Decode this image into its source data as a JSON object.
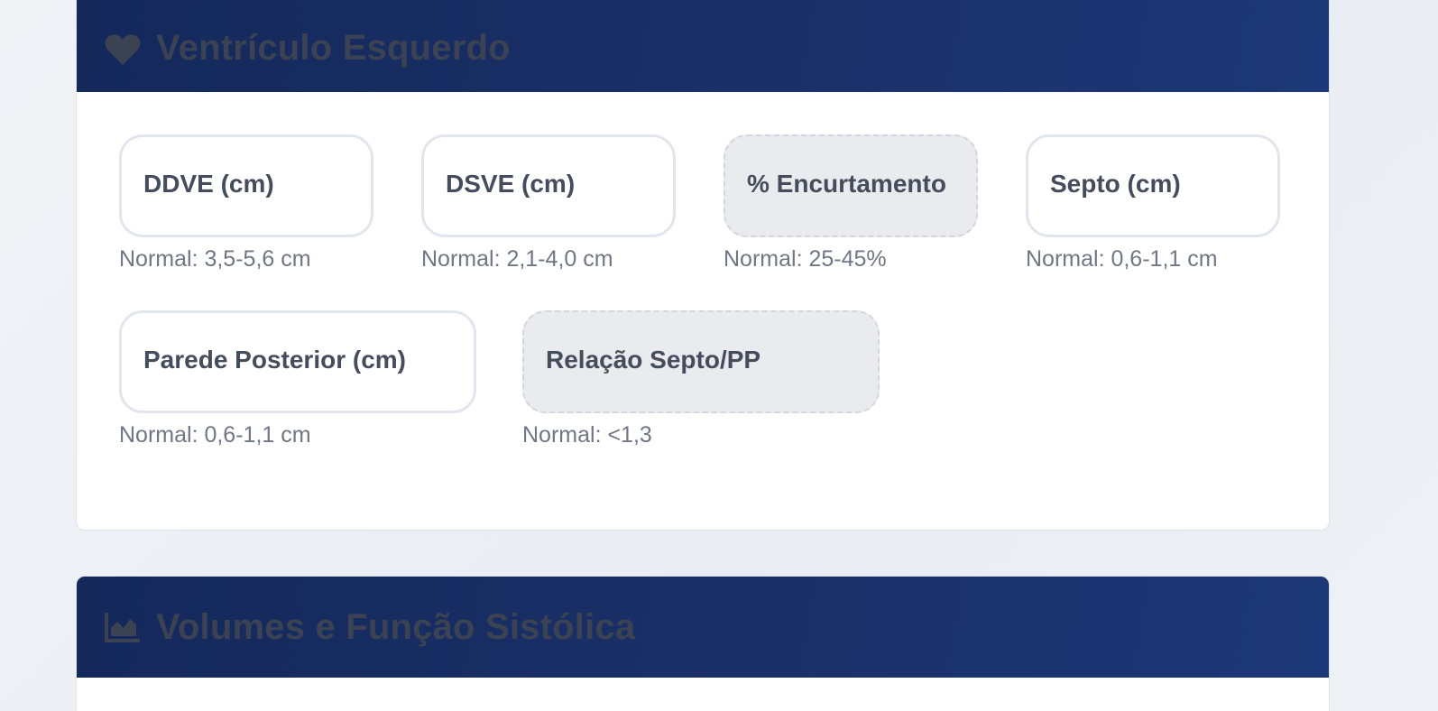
{
  "sections": {
    "lv": {
      "title": "Ventrículo Esquerdo",
      "icon": "heart-icon",
      "fields": [
        {
          "label": "DDVE (cm)",
          "hint": "Normal: 3,5-5,6 cm",
          "readonly": false
        },
        {
          "label": "DSVE (cm)",
          "hint": "Normal: 2,1-4,0 cm",
          "readonly": false
        },
        {
          "label": "% Encurtamento",
          "hint": "Normal: 25-45%",
          "readonly": true
        },
        {
          "label": "Septo (cm)",
          "hint": "Normal: 0,6-1,1 cm",
          "readonly": false
        },
        {
          "label": "Parede Posterior (cm)",
          "hint": "Normal: 0,6-1,1 cm",
          "readonly": false
        },
        {
          "label": "Relação Septo/PP",
          "hint": "Normal: <1,3",
          "readonly": true
        }
      ]
    },
    "volumes": {
      "title": "Volumes e Função Sistólica",
      "icon": "area-chart-icon"
    }
  },
  "colors": {
    "header_gradient_start": "#14285a",
    "header_gradient_end": "#1d3878",
    "header_text": "#3a4253",
    "readonly_bg": "#eaebef"
  }
}
